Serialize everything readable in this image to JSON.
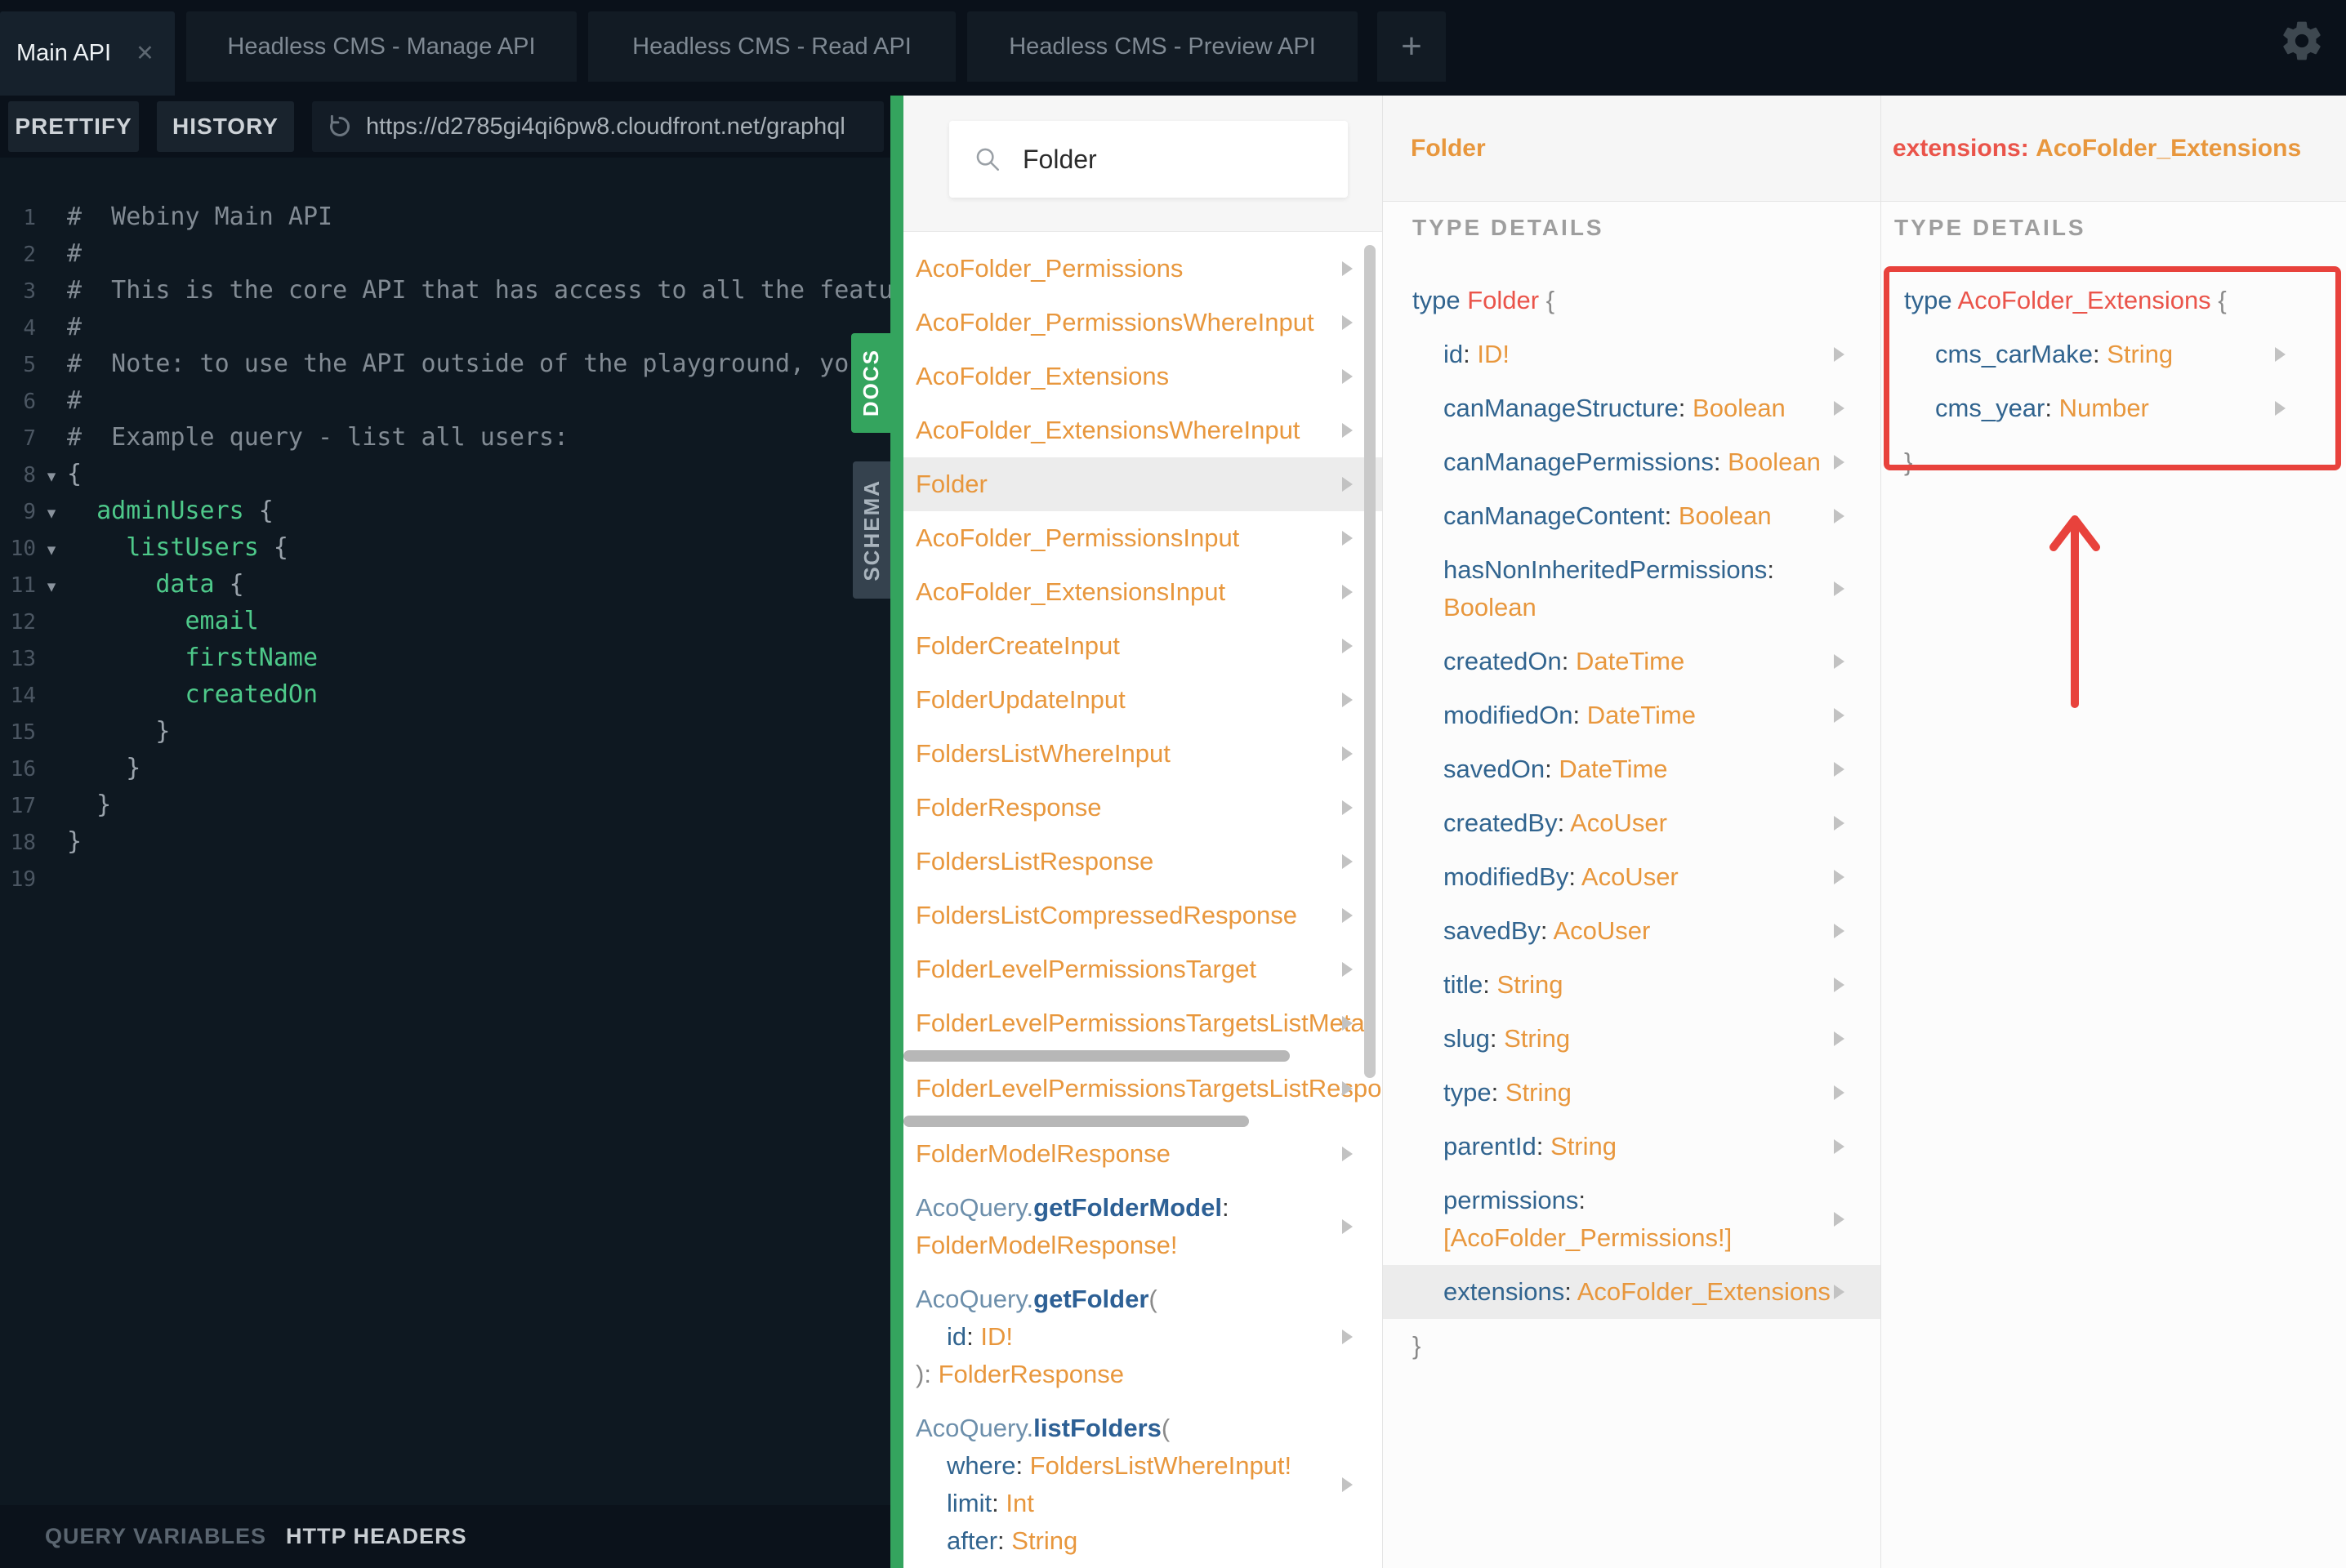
{
  "tabs": {
    "items": [
      {
        "label": "Main API",
        "active": true,
        "closable": true
      },
      {
        "label": "Headless CMS - Manage API",
        "active": false
      },
      {
        "label": "Headless CMS - Read API",
        "active": false
      },
      {
        "label": "Headless CMS - Preview API",
        "active": false
      }
    ],
    "add_button": "+"
  },
  "toolbar": {
    "prettify_label": "PRETTIFY",
    "history_label": "HISTORY",
    "endpoint_url": "https://d2785gi4qi6pw8.cloudfront.net/graphql"
  },
  "editor": {
    "lines": [
      {
        "no": 1,
        "fold": false,
        "segments": [
          {
            "cls": "cm",
            "text": "#  Webiny Main API"
          }
        ]
      },
      {
        "no": 2,
        "fold": false,
        "segments": [
          {
            "cls": "cm",
            "text": "#"
          }
        ]
      },
      {
        "no": 3,
        "fold": false,
        "segments": [
          {
            "cls": "cm",
            "text": "#  This is the core API that has access to all the featu"
          }
        ]
      },
      {
        "no": 4,
        "fold": false,
        "segments": [
          {
            "cls": "cm",
            "text": "#"
          }
        ]
      },
      {
        "no": 5,
        "fold": false,
        "segments": [
          {
            "cls": "cm",
            "text": "#  Note: to use the API outside of the playground, you"
          }
        ]
      },
      {
        "no": 6,
        "fold": false,
        "segments": [
          {
            "cls": "cm",
            "text": "#"
          }
        ]
      },
      {
        "no": 7,
        "fold": false,
        "segments": [
          {
            "cls": "cm",
            "text": "#  Example query - list all users:"
          }
        ]
      },
      {
        "no": 8,
        "fold": true,
        "segments": [
          {
            "cls": "pn",
            "text": "{"
          }
        ]
      },
      {
        "no": 9,
        "fold": true,
        "segments": [
          {
            "cls": "pl",
            "text": "  "
          },
          {
            "cls": "fd",
            "text": "adminUsers"
          },
          {
            "cls": "pn",
            "text": " {"
          }
        ]
      },
      {
        "no": 10,
        "fold": true,
        "segments": [
          {
            "cls": "pl",
            "text": "    "
          },
          {
            "cls": "fd",
            "text": "listUsers"
          },
          {
            "cls": "pn",
            "text": " {"
          }
        ]
      },
      {
        "no": 11,
        "fold": true,
        "segments": [
          {
            "cls": "pl",
            "text": "      "
          },
          {
            "cls": "fd",
            "text": "data"
          },
          {
            "cls": "pn",
            "text": " {"
          }
        ]
      },
      {
        "no": 12,
        "fold": false,
        "segments": [
          {
            "cls": "pl",
            "text": "        "
          },
          {
            "cls": "fd",
            "text": "email"
          }
        ]
      },
      {
        "no": 13,
        "fold": false,
        "segments": [
          {
            "cls": "pl",
            "text": "        "
          },
          {
            "cls": "fd",
            "text": "firstName"
          }
        ]
      },
      {
        "no": 14,
        "fold": false,
        "segments": [
          {
            "cls": "pl",
            "text": "        "
          },
          {
            "cls": "fd",
            "text": "createdOn"
          }
        ]
      },
      {
        "no": 15,
        "fold": false,
        "segments": [
          {
            "cls": "pn",
            "text": "      }"
          }
        ]
      },
      {
        "no": 16,
        "fold": false,
        "segments": [
          {
            "cls": "pn",
            "text": "    }"
          }
        ]
      },
      {
        "no": 17,
        "fold": false,
        "segments": [
          {
            "cls": "pn",
            "text": "  }"
          }
        ]
      },
      {
        "no": 18,
        "fold": false,
        "segments": [
          {
            "cls": "pn",
            "text": "}"
          }
        ]
      },
      {
        "no": 19,
        "fold": false,
        "segments": []
      }
    ]
  },
  "side_tabs": {
    "docs_label": "DOCS",
    "schema_label": "SCHEMA"
  },
  "footer": {
    "query_variables_label": "QUERY VARIABLES",
    "http_headers_label": "HTTP HEADERS"
  },
  "docs": {
    "search": {
      "value": "Folder"
    },
    "items": [
      {
        "kind": "type",
        "label": "AcoFolder_Permissions"
      },
      {
        "kind": "type",
        "label": "AcoFolder_PermissionsWhereInput"
      },
      {
        "kind": "type",
        "label": "AcoFolder_Extensions"
      },
      {
        "kind": "type",
        "label": "AcoFolder_ExtensionsWhereInput"
      },
      {
        "kind": "type",
        "label": "Folder",
        "selected": true
      },
      {
        "kind": "type",
        "label": "AcoFolder_PermissionsInput"
      },
      {
        "kind": "type",
        "label": "AcoFolder_ExtensionsInput"
      },
      {
        "kind": "type",
        "label": "FolderCreateInput"
      },
      {
        "kind": "type",
        "label": "FolderUpdateInput"
      },
      {
        "kind": "type",
        "label": "FoldersListWhereInput"
      },
      {
        "kind": "type",
        "label": "FolderResponse"
      },
      {
        "kind": "type",
        "label": "FoldersListResponse"
      },
      {
        "kind": "type",
        "label": "FoldersListCompressedResponse"
      },
      {
        "kind": "type",
        "label": "FolderLevelPermissionsTarget"
      },
      {
        "kind": "type",
        "label": "FolderLevelPermissionsTargetsListMeta",
        "hscrollbar": true,
        "hscroll_width": 473
      },
      {
        "kind": "type",
        "label": "FolderLevelPermissionsTargetsListRespo",
        "hscrollbar": true,
        "hscroll_width": 423
      },
      {
        "kind": "type",
        "label": "FolderModelResponse"
      },
      {
        "kind": "query",
        "lines": [
          {
            "indent": false,
            "segments": [
              {
                "cls": "ns",
                "text": "AcoQuery."
              },
              {
                "cls": "mn",
                "text": "getFolderModel"
              },
              {
                "cls": "cl",
                "text": ":"
              }
            ]
          },
          {
            "indent": false,
            "segments": [
              {
                "cls": "or",
                "text": "FolderModelResponse!"
              }
            ]
          }
        ]
      },
      {
        "kind": "query",
        "lines": [
          {
            "indent": false,
            "segments": [
              {
                "cls": "ns",
                "text": "AcoQuery."
              },
              {
                "cls": "mn",
                "text": "getFolder"
              },
              {
                "cls": "gr",
                "text": "("
              }
            ]
          },
          {
            "indent": true,
            "segments": [
              {
                "cls": "bl",
                "text": "id"
              },
              {
                "cls": "cl",
                "text": ": "
              },
              {
                "cls": "or",
                "text": "ID!"
              }
            ]
          },
          {
            "indent": false,
            "segments": [
              {
                "cls": "gr",
                "text": "): "
              },
              {
                "cls": "or",
                "text": "FolderResponse"
              }
            ]
          }
        ]
      },
      {
        "kind": "query",
        "lines": [
          {
            "indent": false,
            "segments": [
              {
                "cls": "ns",
                "text": "AcoQuery."
              },
              {
                "cls": "mn",
                "text": "listFolders"
              },
              {
                "cls": "gr",
                "text": "("
              }
            ]
          },
          {
            "indent": true,
            "segments": [
              {
                "cls": "bl",
                "text": "where"
              },
              {
                "cls": "cl",
                "text": ": "
              },
              {
                "cls": "or",
                "text": "FoldersListWhereInput!"
              }
            ]
          },
          {
            "indent": true,
            "segments": [
              {
                "cls": "bl",
                "text": "limit"
              },
              {
                "cls": "cl",
                "text": ": "
              },
              {
                "cls": "or",
                "text": "Int"
              }
            ]
          },
          {
            "indent": true,
            "segments": [
              {
                "cls": "bl",
                "text": "after"
              },
              {
                "cls": "cl",
                "text": ": "
              },
              {
                "cls": "or",
                "text": "String"
              }
            ]
          }
        ]
      }
    ]
  },
  "type_panel": {
    "title": "Folder",
    "section_label": "TYPE DETAILS",
    "declaration": {
      "keyword": "type",
      "name": "Folder",
      "open_brace": "{"
    },
    "fields": [
      {
        "name": "id",
        "type": "ID!"
      },
      {
        "name": "canManageStructure",
        "type": "Boolean"
      },
      {
        "name": "canManagePermissions",
        "type": "Boolean"
      },
      {
        "name": "canManageContent",
        "type": "Boolean"
      },
      {
        "name": "hasNonInheritedPermissions",
        "type": "Boolean"
      },
      {
        "name": "createdOn",
        "type": "DateTime"
      },
      {
        "name": "modifiedOn",
        "type": "DateTime"
      },
      {
        "name": "savedOn",
        "type": "DateTime"
      },
      {
        "name": "createdBy",
        "type": "AcoUser"
      },
      {
        "name": "modifiedBy",
        "type": "AcoUser"
      },
      {
        "name": "savedBy",
        "type": "AcoUser"
      },
      {
        "name": "title",
        "type": "String"
      },
      {
        "name": "slug",
        "type": "String"
      },
      {
        "name": "type",
        "type": "String"
      },
      {
        "name": "parentId",
        "type": "String"
      },
      {
        "name": "permissions",
        "type": "[AcoFolder_Permissions!]"
      },
      {
        "name": "extensions",
        "type": "AcoFolder_Extensions",
        "selected": true
      }
    ],
    "close_brace": "}"
  },
  "extensions_panel": {
    "header": {
      "field": "extensions",
      "separator": ": ",
      "type": "AcoFolder_Extensions"
    },
    "section_label": "TYPE DETAILS",
    "declaration": {
      "keyword": "type",
      "name": "AcoFolder_Extensions",
      "open_brace": "{"
    },
    "fields": [
      {
        "name": "cms_carMake",
        "type": "String"
      },
      {
        "name": "cms_year",
        "type": "Number"
      }
    ],
    "close_brace": "}"
  },
  "colors": {
    "accent_green": "#34a45e",
    "orange": "#e8973d",
    "blue": "#31648f",
    "coral": "#ea544a",
    "annotation_red": "#e8423c",
    "selected_bg": "#ececec",
    "editor_green": "#4ec98a",
    "editor_comment": "#828b94"
  }
}
